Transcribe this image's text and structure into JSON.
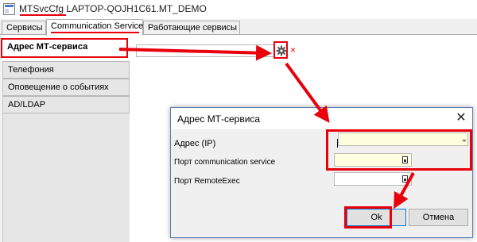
{
  "window": {
    "app_name": "MTSvcCfg",
    "title_rest": "LAPTOP-QOJH1C61.MT_DEMO"
  },
  "tabs": [
    {
      "label": "Сервисы"
    },
    {
      "label": "Communication Service"
    },
    {
      "label": "Работающие сервисы"
    }
  ],
  "sidebar": {
    "items": [
      {
        "label": "Адрес МТ-сервиса"
      },
      {
        "label": "Телефония"
      },
      {
        "label": "Оповещение о событиях"
      },
      {
        "label": "AD/LDAP"
      }
    ]
  },
  "main": {
    "address_value": "",
    "clear_glyph": "×"
  },
  "dialog": {
    "title": "Адрес МТ-сервиса",
    "close_glyph": "✕",
    "address_label": "Адрес (IP)",
    "address_value": "",
    "port_comm_label": "Порт communication service",
    "port_comm_value": "",
    "port_remote_label": "Порт RemoteExec",
    "port_remote_value": "",
    "ok_label": "Ok",
    "cancel_label": "Отмена"
  },
  "colors": {
    "highlight": "#e8000b",
    "input_active": "#ffffe0",
    "focus_border": "#0078d7"
  }
}
